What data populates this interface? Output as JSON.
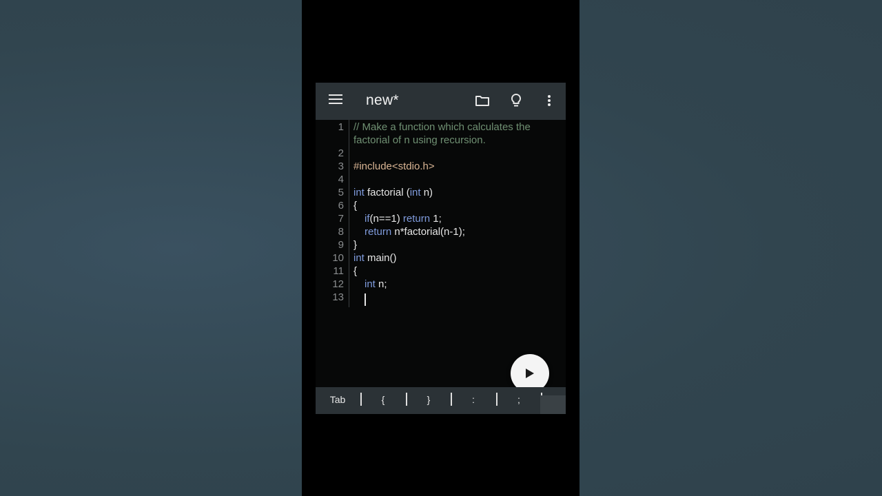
{
  "toolbar": {
    "title": "new*",
    "icons": [
      "menu-icon",
      "folder-icon",
      "lightbulb-icon",
      "more-vert-icon"
    ]
  },
  "editor": {
    "line_numbers": [
      "1",
      "2",
      "3",
      "4",
      "5",
      "6",
      "7",
      "8",
      "9",
      "10",
      "11",
      "12",
      "13"
    ],
    "lines": {
      "l1a": "// Make a function which calculates the",
      "l1b": "factorial of n using recursion.",
      "l3": "#include<stdio.h>",
      "l5_kw1": "int",
      "l5_mid": " factorial (",
      "l5_kw2": "int",
      "l5_end": " n)",
      "l6": "{",
      "l7_kw1": "if",
      "l7_mid": "(n==1) ",
      "l7_kw2": "return",
      "l7_end": " 1;",
      "l8_kw": "return",
      "l8_end": " n*factorial(n-1);",
      "l9": "}",
      "l10_kw": "int",
      "l10_end": " main()",
      "l11": "{",
      "l12_kw": "int",
      "l12_end": " n;"
    },
    "colors": {
      "comment": "#6f8f72",
      "keyword": "#7f9bdc",
      "string": "#d9b594"
    }
  },
  "run_button": {
    "icon": "play-icon"
  },
  "extra_keys": [
    "Tab",
    "{",
    "}",
    ":",
    ";"
  ]
}
